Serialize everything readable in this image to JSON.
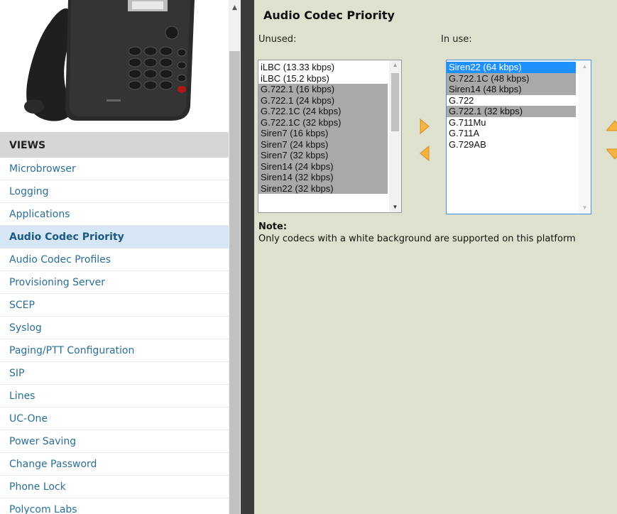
{
  "sidebar": {
    "views_header": "VIEWS",
    "items": [
      {
        "label": "Microbrowser"
      },
      {
        "label": "Logging"
      },
      {
        "label": "Applications"
      },
      {
        "label": "Audio Codec Priority",
        "active": true
      },
      {
        "label": "Audio Codec Profiles"
      },
      {
        "label": "Provisioning Server"
      },
      {
        "label": "SCEP"
      },
      {
        "label": "Syslog"
      },
      {
        "label": "Paging/PTT Configuration"
      },
      {
        "label": "SIP"
      },
      {
        "label": "Lines"
      },
      {
        "label": "UC-One"
      },
      {
        "label": "Power Saving"
      },
      {
        "label": "Change Password"
      },
      {
        "label": "Phone Lock"
      },
      {
        "label": "Polycom Labs"
      }
    ]
  },
  "main": {
    "title": "Audio Codec Priority",
    "unused_label": "Unused:",
    "inuse_label": "In use:",
    "unused_codecs": [
      {
        "label": "iLBC (13.33 kbps)",
        "supported": true
      },
      {
        "label": "iLBC (15.2 kbps)",
        "supported": true
      },
      {
        "label": "G.722.1 (16 kbps)",
        "supported": false
      },
      {
        "label": "G.722.1 (24 kbps)",
        "supported": false
      },
      {
        "label": "G.722.1C (24 kbps)",
        "supported": false
      },
      {
        "label": "G.722.1C (32 kbps)",
        "supported": false
      },
      {
        "label": "Siren7 (16 kbps)",
        "supported": false
      },
      {
        "label": "Siren7 (24 kbps)",
        "supported": false
      },
      {
        "label": "Siren7 (32 kbps)",
        "supported": false
      },
      {
        "label": "Siren14 (24 kbps)",
        "supported": false
      },
      {
        "label": "Siren14 (32 kbps)",
        "supported": false
      },
      {
        "label": "Siren22 (32 kbps)",
        "supported": false
      }
    ],
    "inuse_codecs": [
      {
        "label": "Siren22 (64 kbps)",
        "supported": false,
        "selected": true
      },
      {
        "label": "G.722.1C (48 kbps)",
        "supported": false
      },
      {
        "label": "Siren14 (48 kbps)",
        "supported": false
      },
      {
        "label": "G.722",
        "supported": true
      },
      {
        "label": "G.722.1 (32 kbps)",
        "supported": false
      },
      {
        "label": "G.711Mu",
        "supported": true
      },
      {
        "label": "G.711A",
        "supported": true
      },
      {
        "label": "G.729AB",
        "supported": true
      }
    ],
    "note_title": "Note:",
    "note_text": "Only codecs with a white background are supported on this platform"
  },
  "colors": {
    "main_bg": "#dde1cd",
    "unsupported": "#a9a9a9",
    "selected": "#1e90ff",
    "arrow": "#f5b342",
    "link": "#2a6f97",
    "active_bg": "#d6e6f4"
  },
  "icons": {
    "add": "arrow-right-icon",
    "remove": "arrow-left-icon",
    "move_up": "arrow-up-icon",
    "move_down": "arrow-down-icon"
  }
}
